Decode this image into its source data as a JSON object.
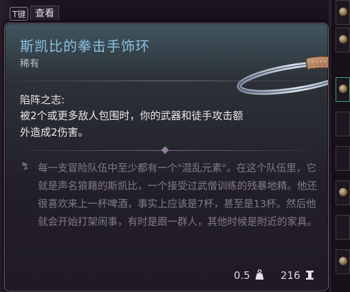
{
  "hotkey_label": "T键",
  "tab_label": "查看",
  "item": {
    "name": "斯凯比的拳击手饰环",
    "rarity": "稀有",
    "passive_name": "陷阵之志:",
    "passive_description": "被2个或更多敌人包围时，你的武器和徒手攻击额外造成2伤害。",
    "lore": "每一支冒险队伍中至少都有一个\"混乱元素\"。在这个队伍里，它就是声名狼藉的斯凯比，一个接受过武僧训练的残暴地精。他还很喜欢来上一杯啤酒，事实上应该是7杯，甚至是13杯。然后他就会开始打架闹事，有时是跟一群人，其他时候是附近的家具。",
    "weight": "0.5",
    "price": "216"
  },
  "colors": {
    "item_name": "#8ec6e8",
    "rarity": "#c6c3c8",
    "lore": "#807c86"
  },
  "icons": {
    "weight": "weight-icon",
    "currency": "gold-coin-icon",
    "lore": "quill-icon"
  }
}
